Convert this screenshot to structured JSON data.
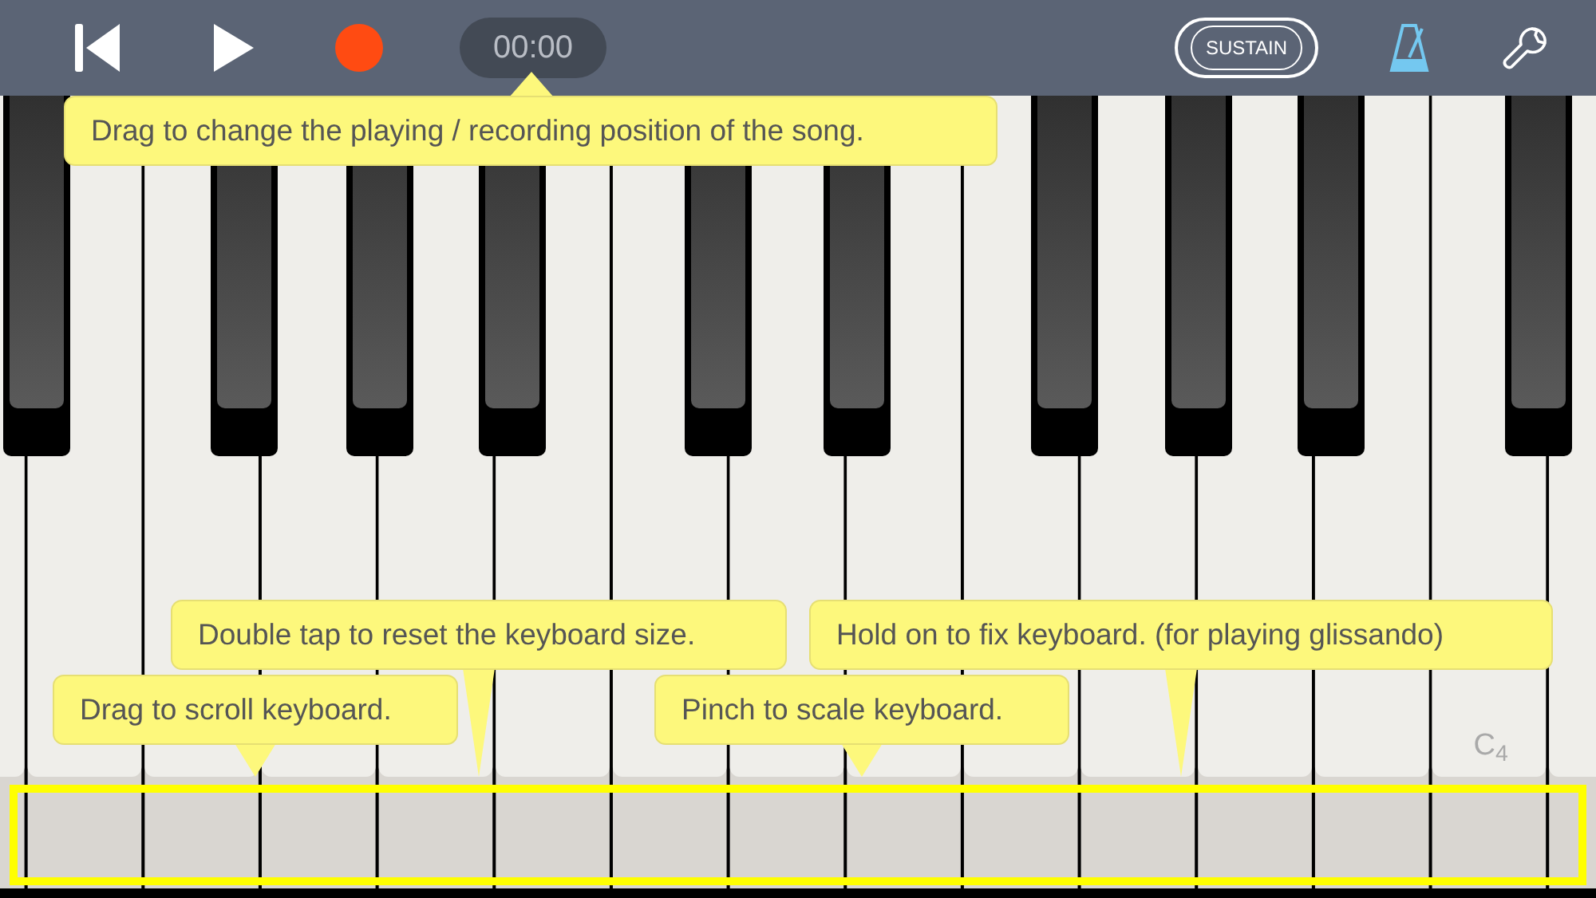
{
  "toolbar": {
    "time": "00:00",
    "sustain": {
      "label": "SUSTAIN",
      "on": false
    }
  },
  "note_labels": [
    {
      "text": "C$_{4}$"
    }
  ],
  "tooltips": [
    {
      "text": "Drag to change the playing / recording position of the song."
    },
    {
      "text": "Double tap to reset the keyboard size."
    },
    {
      "text": "Drag to scroll keyboard."
    },
    {
      "text": "Pinch to scale keyboard."
    },
    {
      "text": "Hold on to fix keyboard. (for playing glissando)"
    }
  ]
}
